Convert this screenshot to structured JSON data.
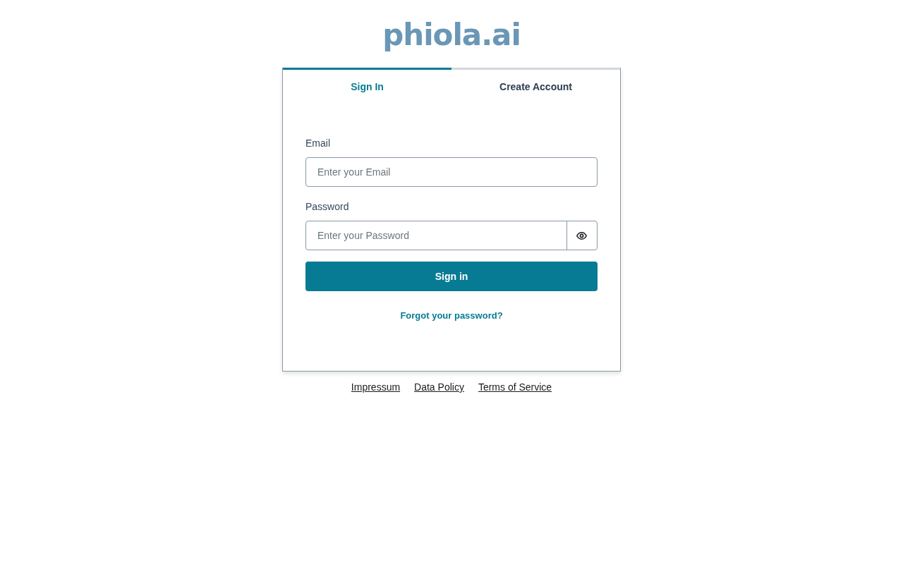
{
  "logo": {
    "text": "phiola.ai"
  },
  "tabs": [
    {
      "label": "Sign In",
      "selected": true
    },
    {
      "label": "Create Account",
      "selected": false
    }
  ],
  "form": {
    "fields": [
      {
        "kind": "email",
        "label": "Email",
        "placeholder": "Enter your Email"
      },
      {
        "kind": "password",
        "label": "Password",
        "placeholder": "Enter your Password"
      }
    ],
    "submit": "Sign in",
    "forgot_link": "Forgot your password?"
  },
  "footer_links": [
    "Impressum",
    "Data Policy",
    "Terms of Service"
  ]
}
